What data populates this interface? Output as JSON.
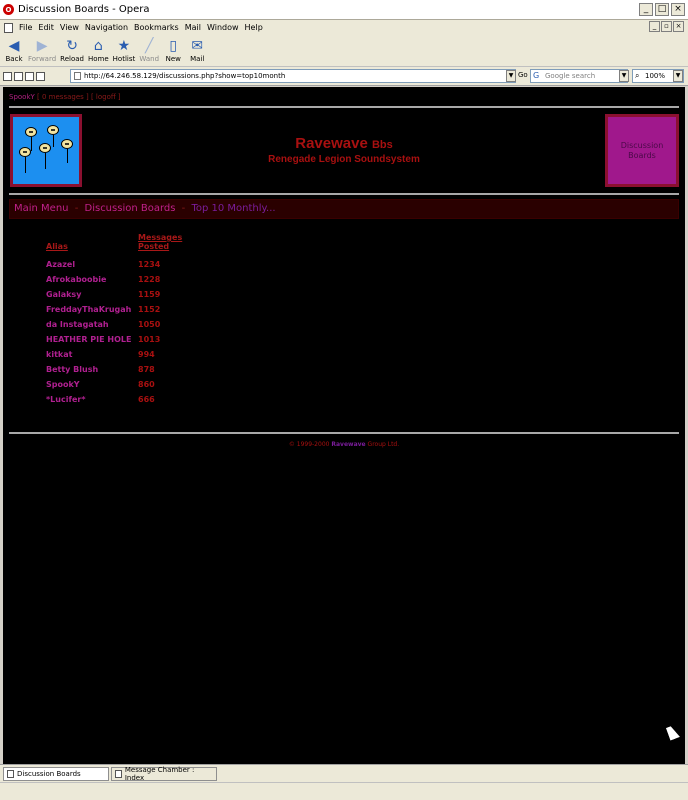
{
  "window": {
    "title": "Discussion Boards - Opera",
    "app_icon": "O"
  },
  "menu": [
    "File",
    "Edit",
    "View",
    "Navigation",
    "Bookmarks",
    "Mail",
    "Window",
    "Help"
  ],
  "toolbar": {
    "back": "Back",
    "forward": "Forward",
    "reload": "Reload",
    "home": "Home",
    "hotlist": "Hotlist",
    "wand": "Wand",
    "new": "New",
    "mail": "Mail"
  },
  "address": {
    "url": "http://64.246.58.129/discussions.php?show=top10month",
    "go_label": "Go",
    "search_placeholder": "Google search",
    "zoom": "100%"
  },
  "userbar": {
    "user": "SpookY",
    "messages": "[ 0 messages ]",
    "logoff": "[ logoff ]"
  },
  "header": {
    "title": "Ravewave",
    "title_suffix": "Bbs",
    "subtitle": "Renegade Legion Soundsystem",
    "side_box": "Discussion Boards"
  },
  "breadcrumb": {
    "main_menu": "Main Menu",
    "separator": "-",
    "boards": "Discussion Boards",
    "current": "Top 10 Monthly..."
  },
  "table": {
    "col_alias": "Alias",
    "col_messages": "Messages Posted",
    "rows": [
      {
        "alias": "Azazel",
        "count": "1234"
      },
      {
        "alias": "Afrokaboobie",
        "count": "1228"
      },
      {
        "alias": "Galaksy",
        "count": "1159"
      },
      {
        "alias": "FreddayThaKrugah",
        "count": "1152"
      },
      {
        "alias": "da Instagatah",
        "count": "1050"
      },
      {
        "alias": "HEATHER PIE HOLE",
        "count": "1013"
      },
      {
        "alias": "kitkat",
        "count": "994"
      },
      {
        "alias": "Betty Blush",
        "count": "878"
      },
      {
        "alias": "SpookY",
        "count": "860"
      },
      {
        "alias": "*Lucifer*",
        "count": "666"
      }
    ]
  },
  "footer": {
    "prefix": "© 1999-2000",
    "brand": "Ravewave",
    "suffix": "Group Ltd."
  },
  "tabs": [
    {
      "label": "Discussion Boards",
      "active": true
    },
    {
      "label": "Message Chamber : Index",
      "active": false
    }
  ],
  "colors": {
    "page_bg": "#000000",
    "dark_red": "#a81010",
    "magenta": "#b02090",
    "purple": "#7a1c9a",
    "logo_blue": "#1c8ff0"
  }
}
